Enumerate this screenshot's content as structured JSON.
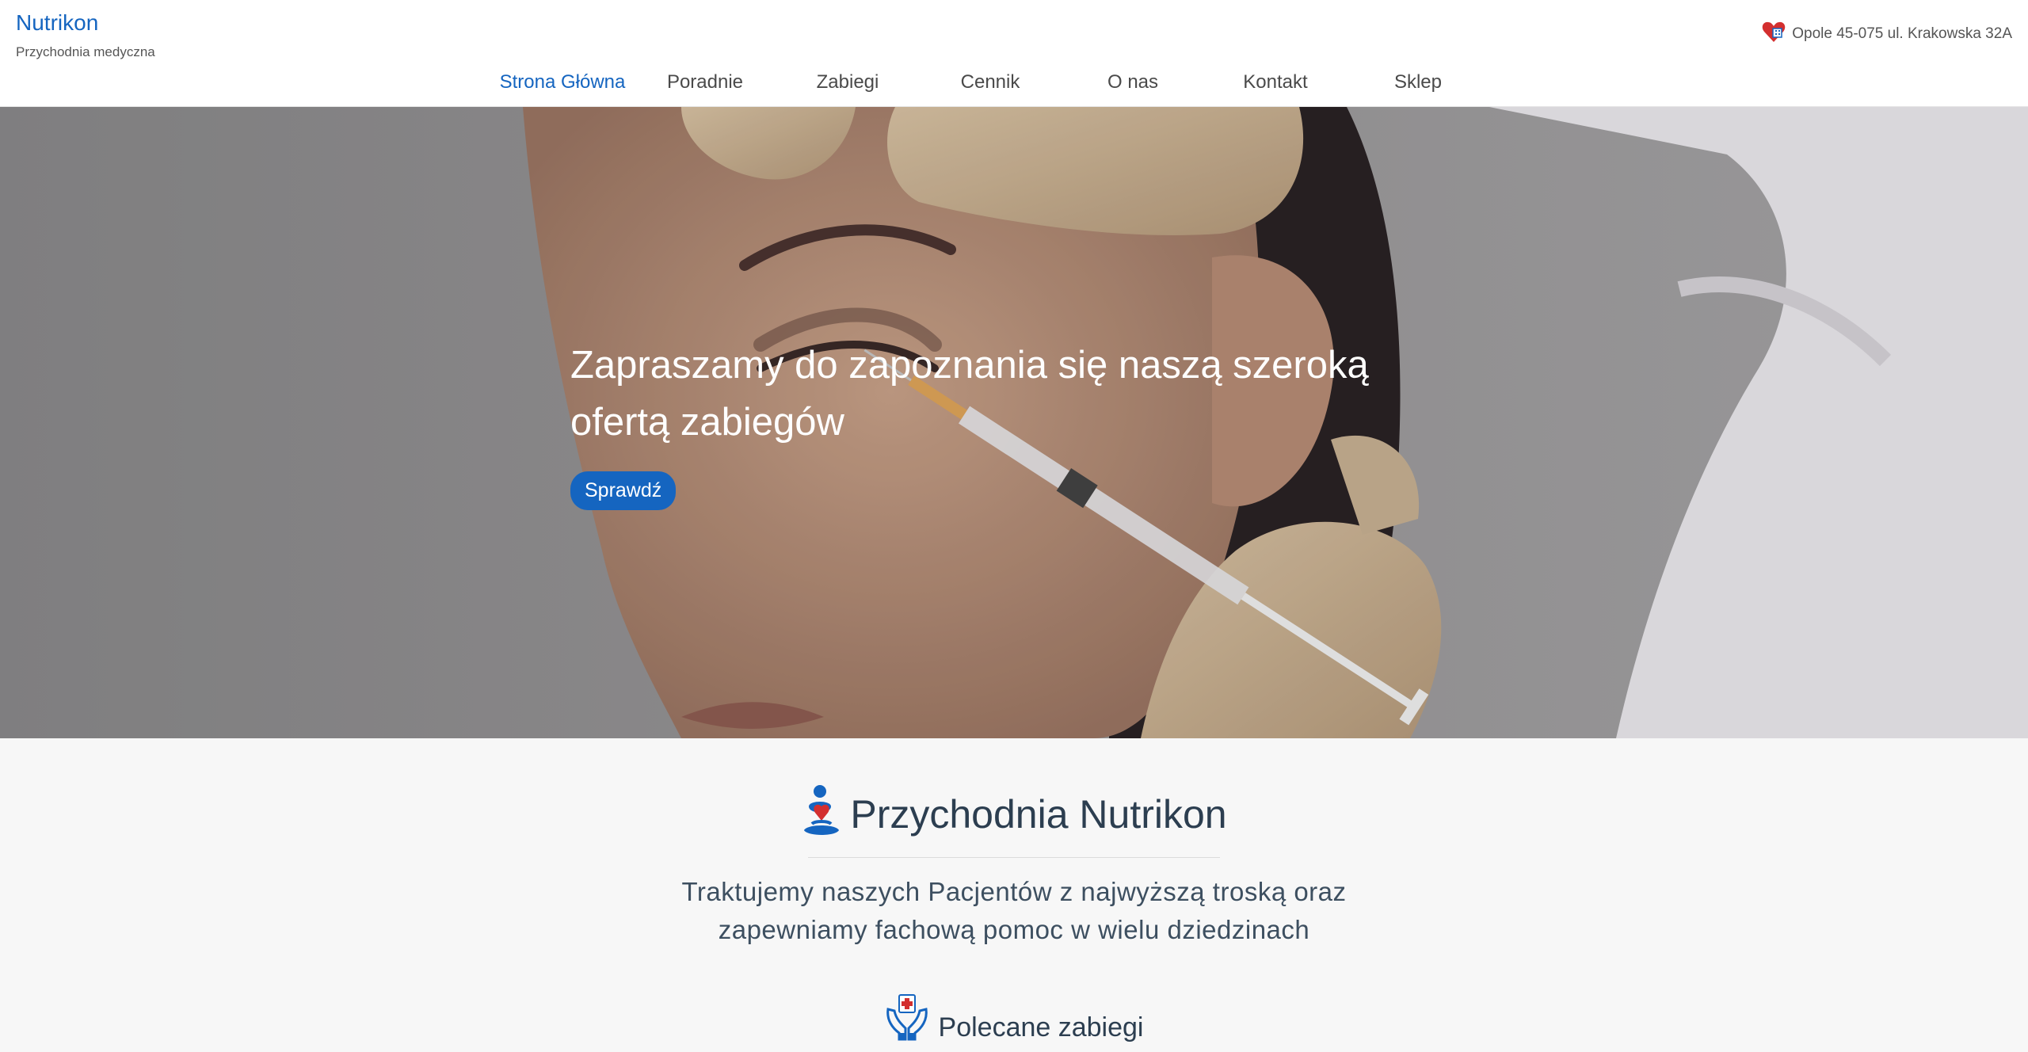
{
  "brand": {
    "name": "Nutrikon",
    "tagline": "Przychodnia medyczna"
  },
  "header": {
    "address": "Opole 45-075 ul. Krakowska 32A",
    "address_icon": "heart-hospital-icon"
  },
  "nav": {
    "items": [
      {
        "label": "Strona Główna",
        "active": true
      },
      {
        "label": "Poradnie",
        "active": false
      },
      {
        "label": "Zabiegi",
        "active": false
      },
      {
        "label": "Cennik",
        "active": false
      },
      {
        "label": "O nas",
        "active": false
      },
      {
        "label": "Kontakt",
        "active": false
      },
      {
        "label": "Sklep",
        "active": false
      }
    ]
  },
  "hero": {
    "headline": "Zapraszamy do zapoznania się naszą szeroką ofertą zabiegów",
    "button_label": "Sprawdź"
  },
  "about": {
    "title": "Przychodnia Nutrikon",
    "title_icon": "clinic-logo-icon",
    "description": "Traktujemy naszych Pacjentów z najwyższą troską oraz zapewniamy fachową pomoc w wielu dziedzinach"
  },
  "featured": {
    "label": "Polecane zabiegi",
    "icon": "hands-medical-icon"
  },
  "colors": {
    "accent": "#1565c0",
    "text": "#2c3e50",
    "hero_bg": "#8e8c8e",
    "section_bg": "#f7f7f7"
  }
}
